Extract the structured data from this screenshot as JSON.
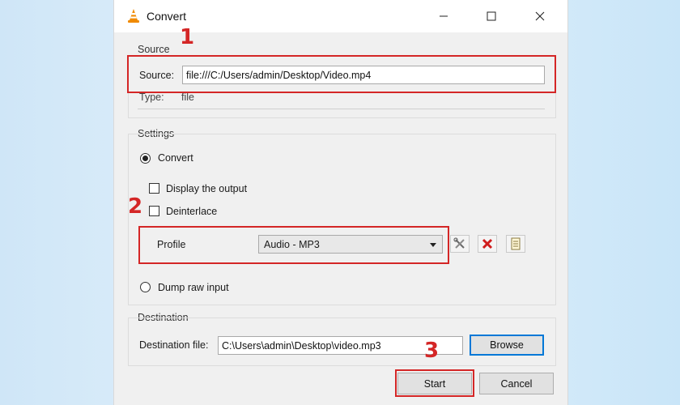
{
  "window": {
    "title": "Convert",
    "icon": "vlc-cone-icon"
  },
  "source": {
    "group_label": "Source",
    "source_label": "Source:",
    "source_value": "file:///C:/Users/admin/Desktop/Video.mp4",
    "type_label": "Type:",
    "type_value": "file"
  },
  "settings": {
    "group_label": "Settings",
    "convert_label": "Convert",
    "convert_selected": true,
    "display_output_label": "Display the output",
    "display_output_checked": false,
    "deinterlace_label": "Deinterlace",
    "deinterlace_checked": false,
    "profile_label": "Profile",
    "profile_value": "Audio - MP3",
    "dump_raw_label": "Dump raw input",
    "dump_raw_selected": false
  },
  "destination": {
    "group_label": "Destination",
    "file_label": "Destination file:",
    "file_value": "C:\\Users\\admin\\Desktop\\video.mp3",
    "browse_label": "Browse"
  },
  "buttons": {
    "start_label": "Start",
    "cancel_label": "Cancel"
  },
  "annotations": {
    "step1": "1",
    "step2": "2",
    "step3": "3",
    "highlight_color": "#d42626"
  }
}
